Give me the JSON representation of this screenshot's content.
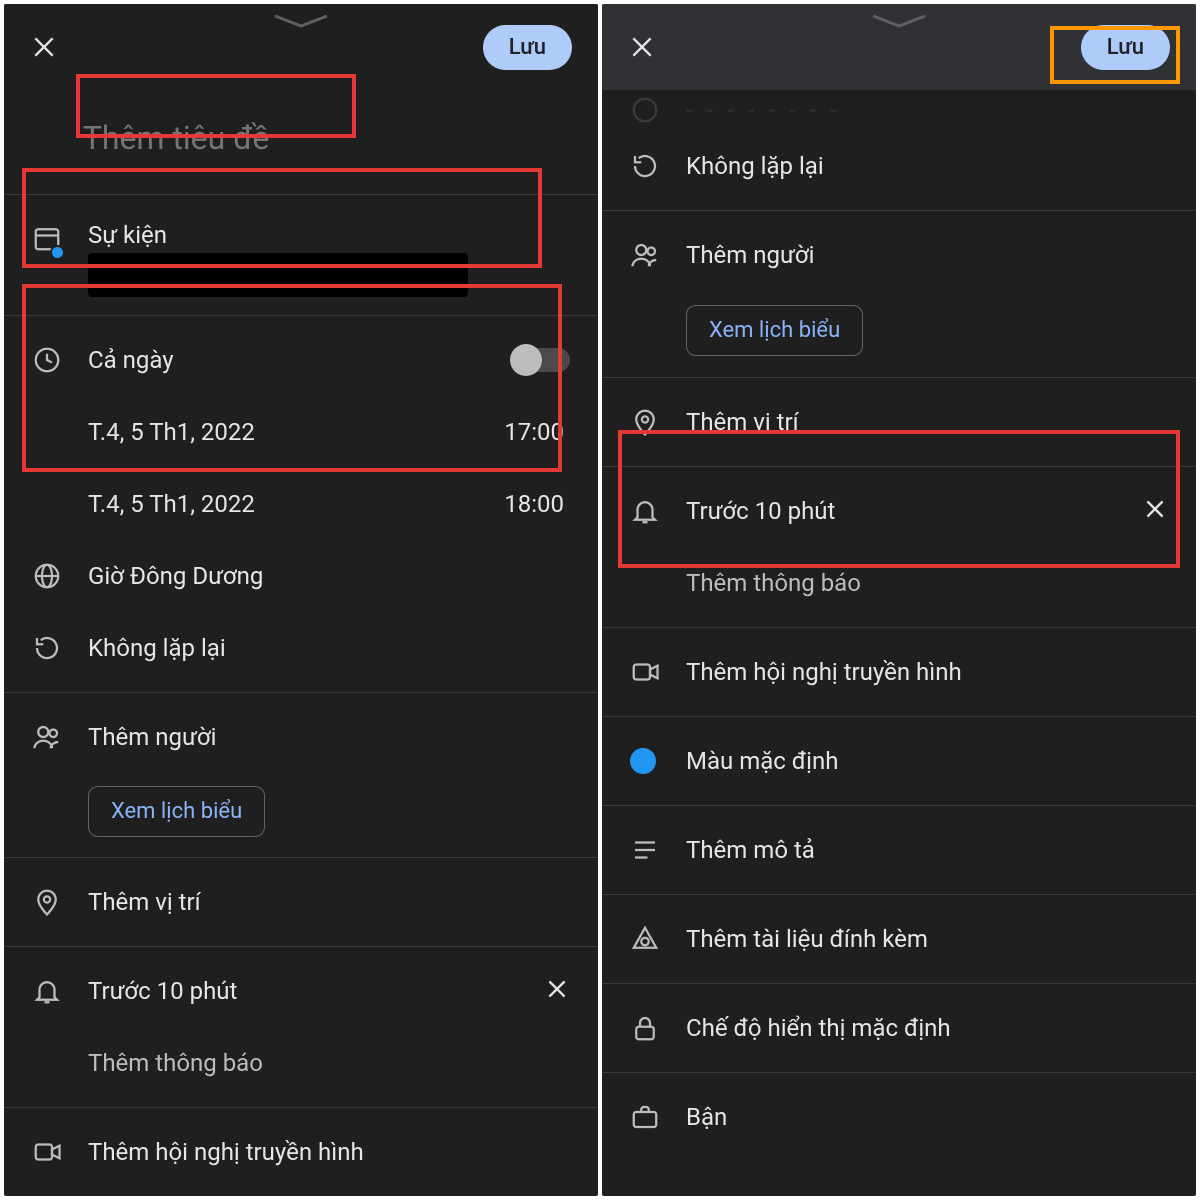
{
  "left": {
    "save": "Lưu",
    "title_placeholder": "Thêm tiêu đề",
    "event_label": "Sự kiện",
    "allday": "Cả ngày",
    "start_date": "T.4, 5 Th1, 2022",
    "start_time": "17:00",
    "end_date": "T.4, 5 Th1, 2022",
    "end_time": "18:00",
    "timezone": "Giờ Đông Dương",
    "repeat": "Không lặp lại",
    "add_people": "Thêm người",
    "view_schedule": "Xem lịch biểu",
    "add_location": "Thêm vị trí",
    "notif_before": "Trước 10 phút",
    "add_notif": "Thêm thông báo",
    "add_video": "Thêm hội nghị truyền hình"
  },
  "right": {
    "save": "Lưu",
    "partial_top": "",
    "repeat": "Không lặp lại",
    "add_people": "Thêm người",
    "view_schedule": "Xem lịch biểu",
    "add_location": "Thêm vị trí",
    "notif_before": "Trước 10 phút",
    "add_notif": "Thêm thông báo",
    "add_video": "Thêm hội nghị truyền hình",
    "default_color": "Màu mặc định",
    "add_desc": "Thêm mô tả",
    "add_attach": "Thêm tài liệu đính kèm",
    "visibility": "Chế độ hiển thị mặc định",
    "busy": "Bận"
  }
}
